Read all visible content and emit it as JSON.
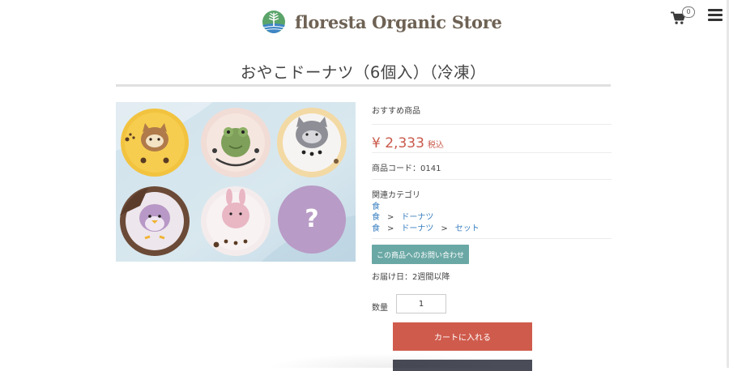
{
  "header": {
    "store_name": "floresta Organic Store",
    "cart_count": "0",
    "icons": {
      "logo": "tree-logo-icon",
      "cart": "cart-icon",
      "menu": "hamburger-menu-icon"
    }
  },
  "product": {
    "title": "おやこドーナツ（6個入）（冷凍）",
    "recommended_label": "おすすめ商品",
    "price": "¥ 2,333",
    "tax_label": "税込",
    "code_label": "商品コード：",
    "code": "0141",
    "category_label": "関連カテゴリ",
    "categories": [
      [
        "食"
      ],
      [
        "食",
        "ドーナツ"
      ],
      [
        "食",
        "ドーナツ",
        "セット"
      ]
    ],
    "separator": ">",
    "inquiry_button": "この商品へのお問い合わせ",
    "delivery": "お届け日：2週間以降",
    "quantity_label": "数量",
    "quantity": "1",
    "add_to_cart": "カートに入れる",
    "mystery_mark": "?"
  },
  "colors": {
    "price": "#c9594b",
    "link": "#3a7fc0",
    "inquiry": "#6aa8a5",
    "cart_button": "#cf5b4c",
    "dark_button": "#4a4d58",
    "logo_text": "#6e6254"
  }
}
